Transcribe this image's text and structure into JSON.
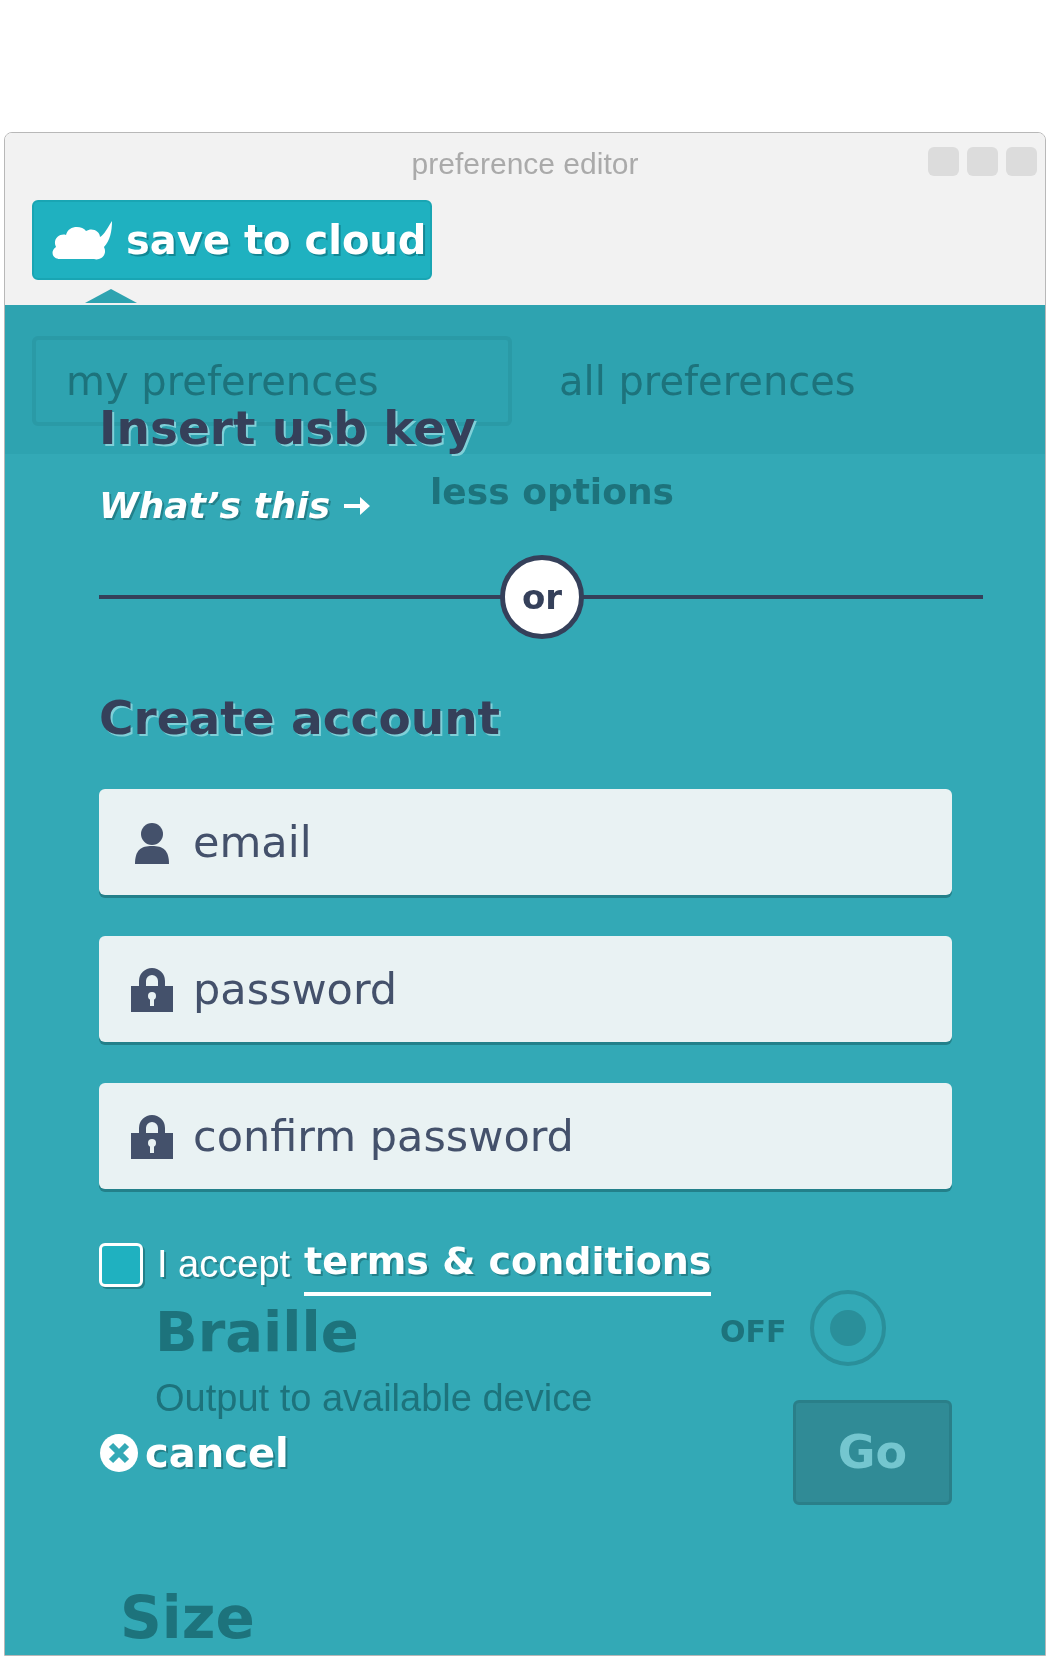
{
  "window": {
    "title": "preference editor"
  },
  "save_button": {
    "label": "save to cloud"
  },
  "background": {
    "tabs": [
      {
        "label": "my preferences",
        "selected": true
      },
      {
        "label": "all preferences",
        "selected": false
      }
    ],
    "less_options": "less options",
    "braille": {
      "title": "Braille",
      "switch": "OFF",
      "on": false,
      "description": "Output to available device"
    },
    "size": {
      "title": "Size"
    }
  },
  "dialog": {
    "usb_title": "Insert usb key",
    "whats_this": "What’s this",
    "or": "or",
    "account_title": "Create account",
    "fields": [
      {
        "placeholder": "email",
        "kind": "user"
      },
      {
        "placeholder": "password",
        "kind": "lock"
      },
      {
        "placeholder": "confirm password",
        "kind": "lock"
      }
    ],
    "terms": {
      "checked": false,
      "prefix": "I accept",
      "link": "terms & conditions"
    },
    "cancel": "cancel",
    "go": {
      "label": "Go",
      "disabled": true
    }
  }
}
